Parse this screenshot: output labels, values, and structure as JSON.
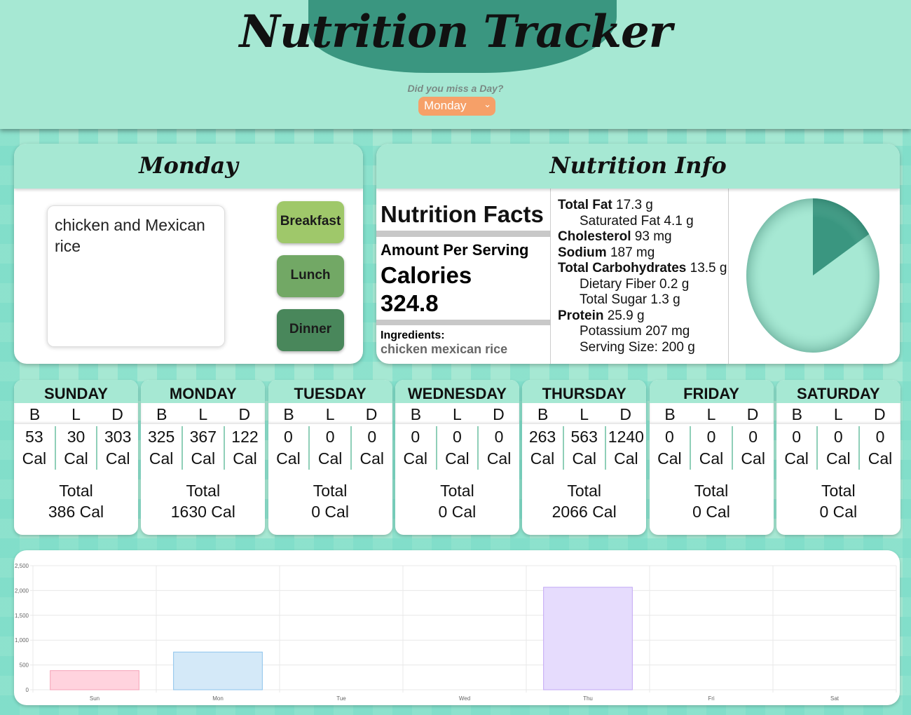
{
  "app": {
    "title": "Nutrition Tracker",
    "miss_day_label": "Did you miss a Day?",
    "day_select_value": "Monday"
  },
  "day_panel": {
    "title": "Monday",
    "food_input_value": "chicken and Mexican rice",
    "buttons": {
      "breakfast": "Breakfast",
      "lunch": "Lunch",
      "dinner": "Dinner"
    }
  },
  "nutrition_info": {
    "title": "Nutrition Info",
    "facts_title": "Nutrition Facts",
    "amount_per_serving": "Amount Per Serving",
    "calories_label": "Calories",
    "calories_value": "324.8",
    "ingredients_label": "Ingredients:",
    "ingredients_value": "chicken mexican rice",
    "nutrients": [
      {
        "label": "Total Fat",
        "value": "17.3 g",
        "bold": true
      },
      {
        "label": "Saturated Fat",
        "value": "4.1 g",
        "bold": false
      },
      {
        "label": "Cholesterol",
        "value": "93 mg",
        "bold": true
      },
      {
        "label": "Sodium",
        "value": "187 mg",
        "bold": true
      },
      {
        "label": "Total Carbohydrates",
        "value": "13.5 g",
        "bold": true
      },
      {
        "label": "Dietary Fiber",
        "value": "0.2 g",
        "bold": false
      },
      {
        "label": "Total Sugar",
        "value": "1.3 g",
        "bold": false
      },
      {
        "label": "Protein",
        "value": "25.9 g",
        "bold": true
      },
      {
        "label": "Potassium",
        "value": "207 mg",
        "bold": false
      },
      {
        "label": "Serving Size:",
        "value": "200 g",
        "bold": false
      }
    ],
    "pie": {
      "fraction": 0.16,
      "fill_color": "#3a9680",
      "base_color": "#a6e8d3"
    }
  },
  "week": {
    "meal_letters": [
      "B",
      "L",
      "D"
    ],
    "cal_unit": "Cal",
    "total_label": "Total",
    "days": [
      {
        "name": "SUNDAY",
        "values": [
          "53",
          "30",
          "303"
        ],
        "total": "386 Cal"
      },
      {
        "name": "MONDAY",
        "values": [
          "325",
          "367",
          "122"
        ],
        "total": "1630 Cal"
      },
      {
        "name": "TUESDAY",
        "values": [
          "0",
          "0",
          "0"
        ],
        "total": "0 Cal"
      },
      {
        "name": "WEDNESDAY",
        "values": [
          "0",
          "0",
          "0"
        ],
        "total": "0 Cal"
      },
      {
        "name": "THURSDAY",
        "values": [
          "263",
          "563",
          "1240"
        ],
        "total": "2066 Cal"
      },
      {
        "name": "FRIDAY",
        "values": [
          "0",
          "0",
          "0"
        ],
        "total": "0 Cal"
      },
      {
        "name": "SATURDAY",
        "values": [
          "0",
          "0",
          "0"
        ],
        "total": "0 Cal"
      }
    ]
  },
  "chart_data": {
    "type": "bar",
    "categories": [
      "Sun",
      "Mon",
      "Tue",
      "Wed",
      "Thu",
      "Fri",
      "Sat"
    ],
    "values": [
      386,
      760,
      0,
      0,
      2066,
      0,
      0
    ],
    "ylim": [
      0,
      2500
    ],
    "yticks": [
      "0",
      "500",
      "1,000",
      "1,500",
      "2,000",
      "2,500"
    ],
    "grid": true,
    "colors": [
      "#ffd3de",
      "#d4e9f8",
      "#f0e0e0",
      "#f7ead0",
      "#e6dcfd",
      "#d9f2ec",
      "#f2f2f2"
    ],
    "border_colors": [
      "#f5a3b8",
      "#8cc3ec",
      "#e0a0a0",
      "#e8c080",
      "#c3a8f5",
      "#90d6c5",
      "#cccccc"
    ]
  }
}
